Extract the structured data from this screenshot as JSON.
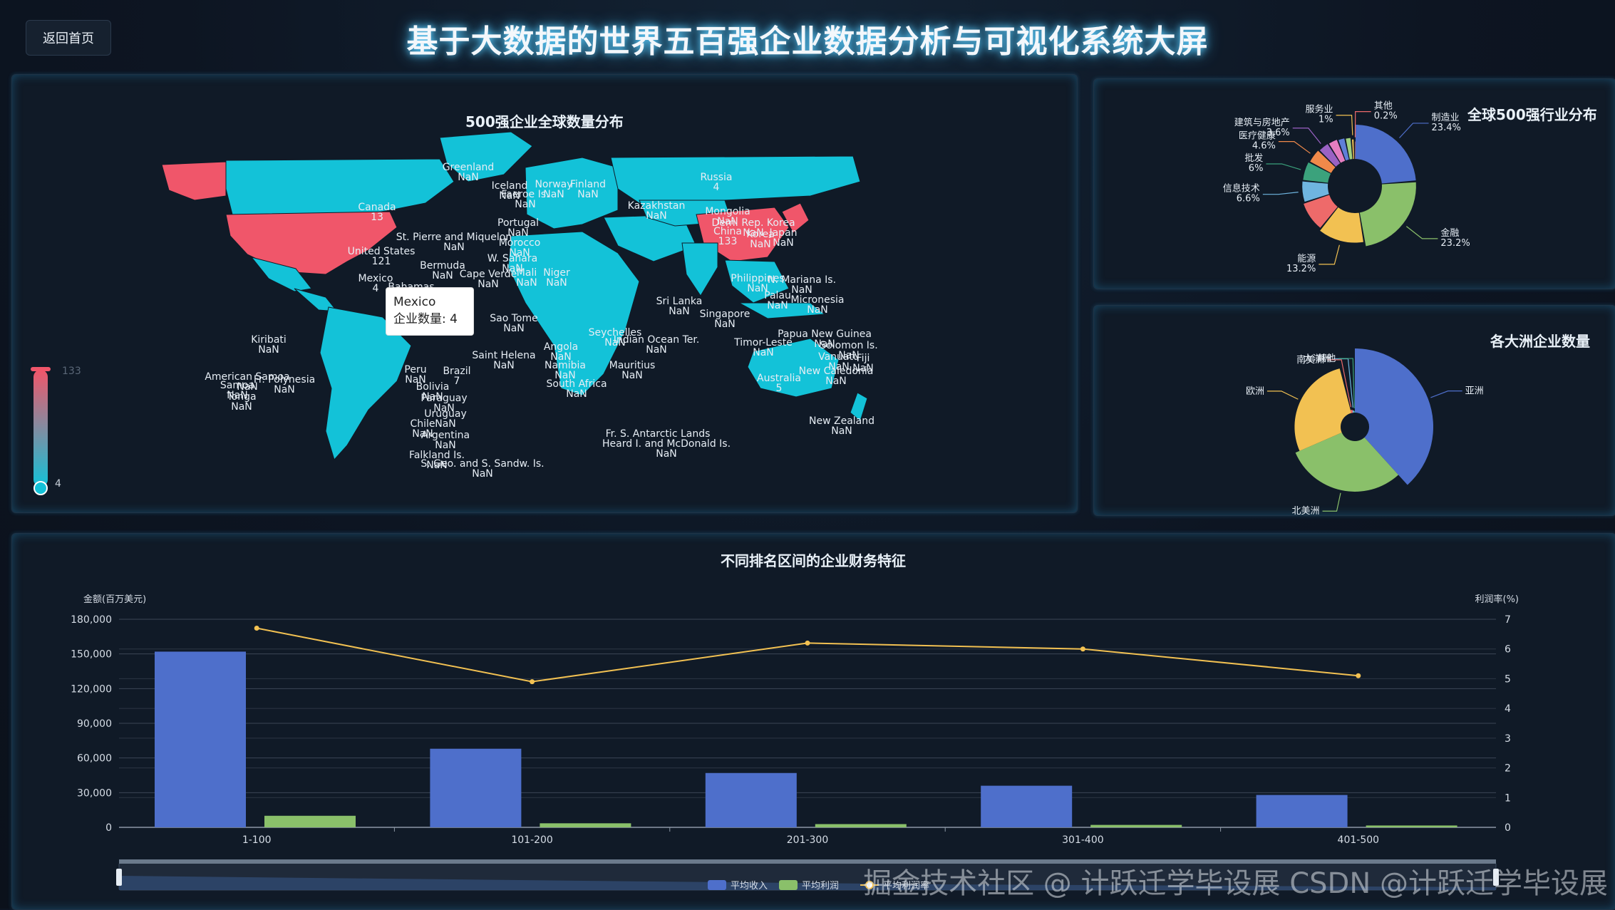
{
  "header": {
    "back_label": "返回首页",
    "title": "基于大数据的世界五百强企业数据分析与可视化系统大屏"
  },
  "map": {
    "title": "500强企业全球数量分布",
    "visual_map": {
      "max_label": "133",
      "min_label": "4"
    },
    "tooltip": {
      "country": "Mexico",
      "label": "企业数量: 4"
    },
    "labels": [
      {
        "name": "Greenland",
        "value": "NaN"
      },
      {
        "name": "Canada",
        "value": "13"
      },
      {
        "name": "St. Pierre and Miquelon",
        "value": "NaN"
      },
      {
        "name": "United States",
        "value": "121"
      },
      {
        "name": "Bermuda",
        "value": "NaN"
      },
      {
        "name": "Mexico",
        "value": "4"
      },
      {
        "name": "Bahamas",
        "value": "NaN"
      },
      {
        "name": "Kiribati",
        "value": "NaN"
      },
      {
        "name": "American Samoa",
        "value": "NaN"
      },
      {
        "name": "Fr. Polynesia",
        "value": "NaN"
      },
      {
        "name": "Samoa",
        "value": "NaN"
      },
      {
        "name": "Tonga",
        "value": "NaN"
      },
      {
        "name": "Peru",
        "value": "NaN"
      },
      {
        "name": "Brazil",
        "value": "7"
      },
      {
        "name": "Bolivia",
        "value": "NaN"
      },
      {
        "name": "Paraguay",
        "value": "NaN"
      },
      {
        "name": "Uruguay",
        "value": "NaN"
      },
      {
        "name": "Chile",
        "value": "NaN"
      },
      {
        "name": "Argentina",
        "value": "NaN"
      },
      {
        "name": "Falkland Is.",
        "value": "NaN"
      },
      {
        "name": "S. Geo. and S. Sandw. Is.",
        "value": "NaN"
      },
      {
        "name": "Iceland",
        "value": "NaN"
      },
      {
        "name": "Faeroe Is.",
        "value": "NaN"
      },
      {
        "name": "Norway",
        "value": "NaN"
      },
      {
        "name": "Finland",
        "value": "NaN"
      },
      {
        "name": "Russia",
        "value": "4"
      },
      {
        "name": "Kazakhstan",
        "value": "NaN"
      },
      {
        "name": "Mongolia",
        "value": "NaN"
      },
      {
        "name": "China",
        "value": "133"
      },
      {
        "name": "Dem. Rep. Korea",
        "value": "NaN"
      },
      {
        "name": "Korea",
        "value": "NaN"
      },
      {
        "name": "Japan",
        "value": "NaN"
      },
      {
        "name": "Portugal",
        "value": "NaN"
      },
      {
        "name": "Morocco",
        "value": "NaN"
      },
      {
        "name": "W. Sahara",
        "value": "NaN"
      },
      {
        "name": "Mali",
        "value": "NaN"
      },
      {
        "name": "Niger",
        "value": "NaN"
      },
      {
        "name": "Cape Verde",
        "value": "NaN"
      },
      {
        "name": "Saint Helena",
        "value": "NaN"
      },
      {
        "name": "Sao Tome",
        "value": "NaN"
      },
      {
        "name": "Angola",
        "value": "NaN"
      },
      {
        "name": "Namibia",
        "value": "NaN"
      },
      {
        "name": "South Africa",
        "value": "NaN"
      },
      {
        "name": "Seychelles",
        "value": "NaN"
      },
      {
        "name": "Indian Ocean Ter.",
        "value": "NaN"
      },
      {
        "name": "Mauritius",
        "value": "NaN"
      },
      {
        "name": "Sri Lanka",
        "value": "NaN"
      },
      {
        "name": "Philippines",
        "value": "NaN"
      },
      {
        "name": "N. Mariana Is.",
        "value": "NaN"
      },
      {
        "name": "Palau",
        "value": "NaN"
      },
      {
        "name": "Micronesia",
        "value": "NaN"
      },
      {
        "name": "Singapore",
        "value": "NaN"
      },
      {
        "name": "Papua New Guinea",
        "value": "NaN"
      },
      {
        "name": "Timor-Leste",
        "value": "NaN"
      },
      {
        "name": "Solomon Is.",
        "value": "NaN"
      },
      {
        "name": "Vanuatu",
        "value": "NaN"
      },
      {
        "name": "Fiji",
        "value": "NaN"
      },
      {
        "name": "New Caledonia",
        "value": "NaN"
      },
      {
        "name": "Australia",
        "value": "5"
      },
      {
        "name": "New Zealand",
        "value": "NaN"
      },
      {
        "name": "Fr. S. Antarctic Lands",
        "value": ""
      },
      {
        "name": "Heard I. and McDonald Is.",
        "value": "NaN"
      }
    ]
  },
  "colors": {
    "map_high": "#f0566a",
    "map_low": "#13c2d8",
    "bar_revenue": "#4e6fcb",
    "bar_profit": "#8ac06a",
    "line_margin": "#f2c152",
    "axis_text": "#d6dde6"
  },
  "industry": {
    "title": "全球500强行业分布",
    "chart_data": {
      "type": "pie",
      "variant": "nightingale-donut",
      "slices": [
        {
          "name": "制造业",
          "label": "23.4%",
          "value": 23.4,
          "color": "#4e6fcb"
        },
        {
          "name": "金融",
          "label": "23.2%",
          "value": 23.2,
          "color": "#8ac06a"
        },
        {
          "name": "能源",
          "label": "13.2%",
          "value": 13.2,
          "color": "#f2c152"
        },
        {
          "name": "",
          "label": "",
          "value": 9.0,
          "color": "#ee6a6a"
        },
        {
          "name": "信息技术",
          "label": "6.6%",
          "value": 6.6,
          "color": "#6fb5e0"
        },
        {
          "name": "批发",
          "label": "6%",
          "value": 6.0,
          "color": "#3ba27c"
        },
        {
          "name": "医疗健康",
          "label": "4.6%",
          "value": 4.6,
          "color": "#f0894a"
        },
        {
          "name": "建筑与房地产",
          "label": "3.6%",
          "value": 3.6,
          "color": "#9a62c4"
        },
        {
          "name": "",
          "label": "",
          "value": 3.2,
          "color": "#e47ec0"
        },
        {
          "name": "",
          "label": "",
          "value": 2.4,
          "color": "#5f7fd8"
        },
        {
          "name": "",
          "label": "",
          "value": 2.0,
          "color": "#9fd07e"
        },
        {
          "name": "服务业",
          "label": "1%",
          "value": 1.0,
          "color": "#f2c152"
        },
        {
          "name": "其他",
          "label": "0.2%",
          "value": 0.2,
          "color": "#ee6a6a"
        }
      ]
    }
  },
  "continent": {
    "title": "各大洲企业数量",
    "chart_data": {
      "type": "pie",
      "variant": "rose",
      "slices": [
        {
          "name": "亚洲",
          "value": 170,
          "color": "#4e6fcb"
        },
        {
          "name": "北美洲",
          "value": 134,
          "color": "#8ac06a"
        },
        {
          "name": "欧洲",
          "value": 122,
          "color": "#f2c152"
        },
        {
          "name": "南美洲",
          "value": 8,
          "color": "#ee6a6a"
        },
        {
          "name": "大洋洲",
          "value": 6,
          "color": "#6fb5e0"
        },
        {
          "name": "其他",
          "value": 4,
          "color": "#3ba27c"
        }
      ]
    }
  },
  "finance": {
    "title": "不同排名区间的企业财务特征",
    "legend": [
      "平均收入",
      "平均利润",
      "平均利润率"
    ],
    "chart_data": {
      "type": "bar",
      "categories": [
        "1-100",
        "101-200",
        "201-300",
        "301-400",
        "401-500"
      ],
      "ylabel": "金额(百万美元)",
      "y2label": "利润率(%)",
      "ylim": [
        0,
        180000
      ],
      "y2lim": [
        0,
        7
      ],
      "yticks": [
        "0",
        "30,000",
        "60,000",
        "90,000",
        "120,000",
        "150,000",
        "180,000"
      ],
      "y2ticks": [
        "0",
        "1",
        "2",
        "3",
        "4",
        "5",
        "6",
        "7"
      ],
      "series": [
        {
          "name": "平均收入",
          "type": "bar",
          "values": [
            152000,
            68000,
            47000,
            36000,
            28000
          ]
        },
        {
          "name": "平均利润",
          "type": "bar",
          "values": [
            10000,
            3500,
            2800,
            2100,
            1600
          ]
        },
        {
          "name": "平均利润率",
          "type": "line",
          "axis": "right",
          "values": [
            6.7,
            4.9,
            6.2,
            6.0,
            5.1
          ]
        }
      ]
    }
  },
  "watermark": "掘金技术社区 @ 计跃迁学毕设展 CSDN @计跃迁学毕设展"
}
